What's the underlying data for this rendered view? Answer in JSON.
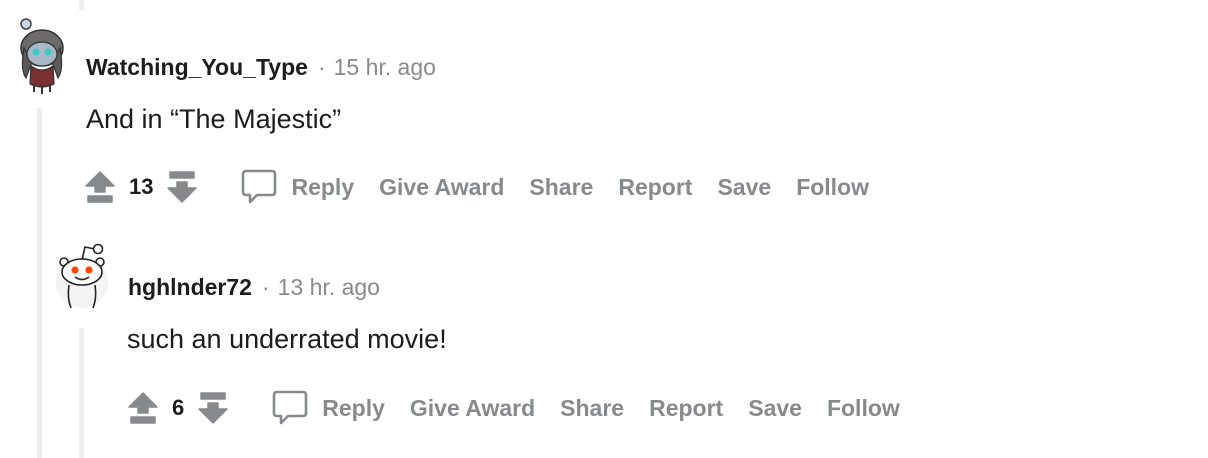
{
  "comments": [
    {
      "username": "Watching_You_Type",
      "separator": "·",
      "time": "15 hr. ago",
      "body": "And in “The Majestic”",
      "score": "13",
      "actions": {
        "reply": "Reply",
        "give_award": "Give Award",
        "share": "Share",
        "report": "Report",
        "save": "Save",
        "follow": "Follow"
      }
    },
    {
      "username": "hghlnder72",
      "separator": "·",
      "time": "13 hr. ago",
      "body": "such an underrated movie!",
      "score": "6",
      "actions": {
        "reply": "Reply",
        "give_award": "Give Award",
        "share": "Share",
        "report": "Report",
        "save": "Save",
        "follow": "Follow"
      }
    }
  ],
  "colors": {
    "text": "#1c1c1c",
    "muted": "#878a8c",
    "thread_line": "#ededed",
    "snoo_eye": "#ff4500"
  },
  "icons": {
    "upvote": "upvote-arrow-icon",
    "downvote": "downvote-arrow-icon",
    "reply": "comment-bubble-icon"
  }
}
